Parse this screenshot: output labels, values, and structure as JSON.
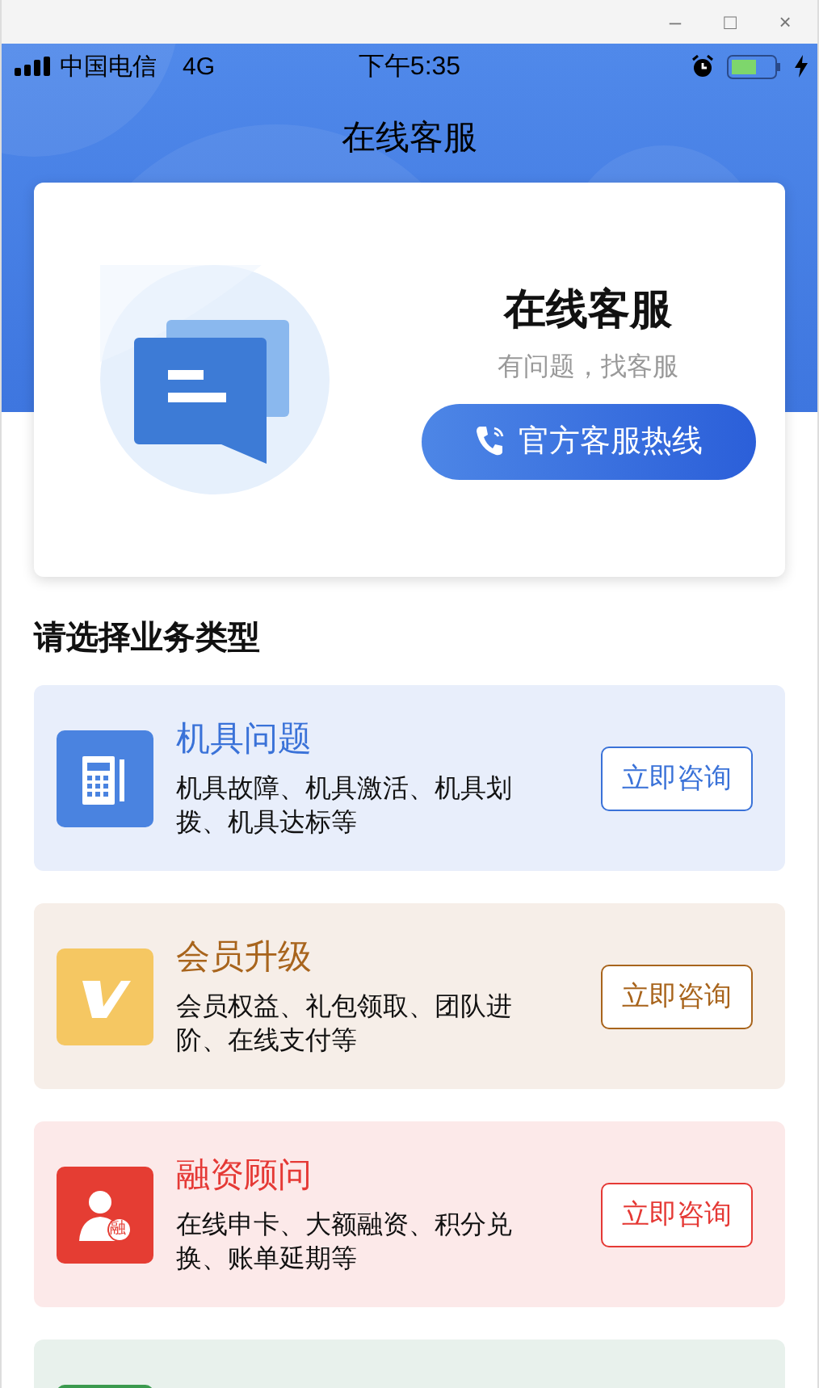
{
  "window": {
    "controls": [
      "–",
      "□",
      "×"
    ]
  },
  "status_bar": {
    "carrier": "中国电信",
    "network": "4G",
    "time": "下午5:35"
  },
  "header": {
    "title": "在线客服"
  },
  "hero": {
    "title": "在线客服",
    "subtitle": "有问题，找客服",
    "button": "官方客服热线"
  },
  "section_title": "请选择业务类型",
  "categories": [
    {
      "kind": "device",
      "title": "机具问题",
      "description": "机具故障、机具激活、机具划拨、机具达标等",
      "button": "立即咨询",
      "color": "#3a72d8"
    },
    {
      "kind": "vip",
      "title": "会员升级",
      "description": "会员权益、礼包领取、团队进阶、在线支付等",
      "button": "立即咨询",
      "color": "#a8641c"
    },
    {
      "kind": "advisor",
      "title": "融资顾问",
      "description": "在线申卡、大额融资、积分兑换、账单延期等",
      "button": "立即咨询",
      "color": "#e53935",
      "icon_text": "融"
    },
    {
      "kind": "app",
      "color": "#3a9a4e"
    }
  ]
}
